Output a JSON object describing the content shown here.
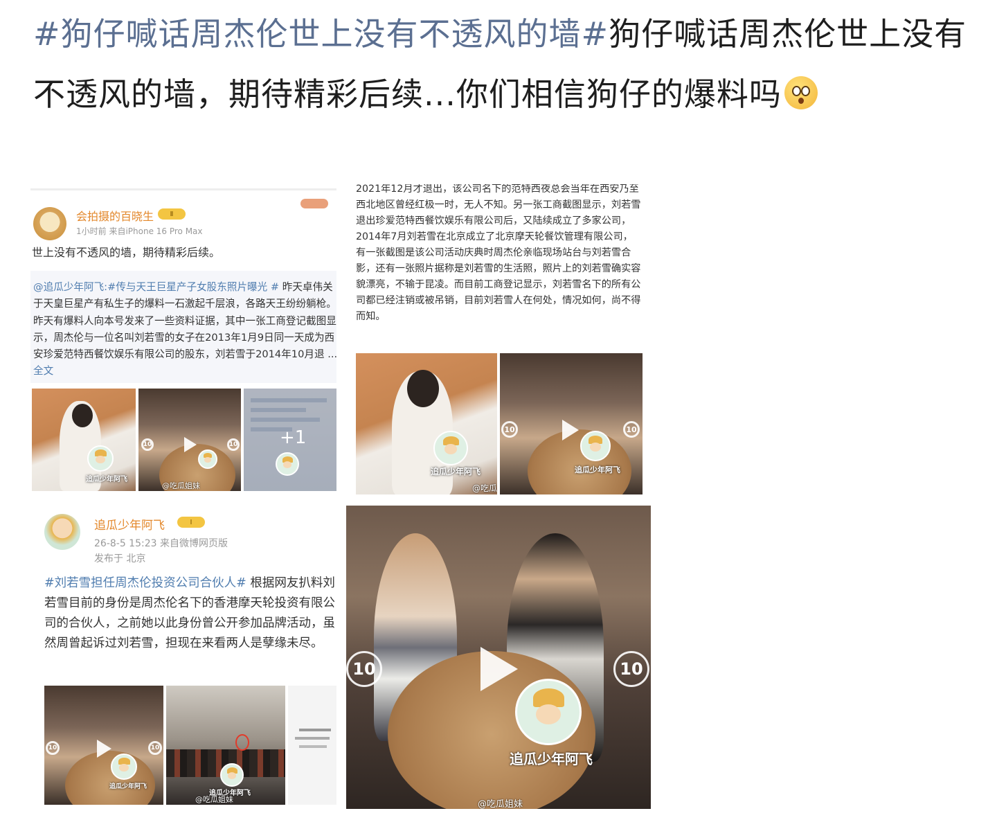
{
  "post": {
    "hashtag": "#狗仔喊话周杰伦世上没有不透风的墙#",
    "text": "狗仔喊话周杰伦世上没有不透风的墙，期待精彩后续...你们相信狗仔的爆料吗"
  },
  "card1": {
    "username": "会拍摄的百晓生",
    "badge": "Ⅱ",
    "meta": "1小时前  来自iPhone 16 Pro Max",
    "text": "世上没有不透风的墙，期待精彩后续。",
    "repost_mention": "@追瓜少年阿飞",
    "repost_tag": ":#传与天王巨星产子女股东照片曝光 #",
    "repost_text": " 昨天卓伟关于天皇巨星产有私生子的爆料一石激起千层浪，各路天王纷纷躺枪。昨天有爆料人向本号发来了一些资料证据，其中一张工商登记截图显示，周杰伦与一位名叫刘若雪的女子在2013年1月9日同一天成为西安珍爱范特西餐饮娱乐有限公司的股东，刘若雪于2014年10月退 ... ",
    "full_text_link": "全文",
    "more_count": "+1",
    "video_watermark": "@吃瓜姐妹",
    "mascot_label": "追瓜少年阿飞",
    "skip": "10"
  },
  "card2": {
    "text": "2021年12月才退出，该公司名下的范特西夜总会当年在西安乃至西北地区曾经红极一时，无人不知。另一张工商截图显示，刘若雪退出珍爱范特西餐饮娱乐有限公司后，又陆续成立了多家公司，2014年7月刘若雪在北京成立了北京摩天轮餐饮管理有限公司，有一张截图是该公司活动庆典时周杰伦亲临现场站台与刘若雪合影，还有一张照片据称是刘若雪的生活照，照片上的刘若雪确实容貌漂亮，不输于昆凌。而目前工商登记显示，刘若雪名下的所有公司都已经注销或被吊销，目前刘若雪人在何处，情况如何，尚不得而知。",
    "watermark": "@吃瓜姐妹",
    "mascot_label": "追瓜少年阿飞",
    "skip": "10"
  },
  "card3": {
    "username": "追瓜少年阿飞",
    "badge": "Ⅰ",
    "meta": "26-8-5 15:23  来自微博网页版",
    "location": "发布于 北京",
    "tag": "#刘若雪担任周杰伦投资公司合伙人#",
    "text": " 根据网友扒料刘若雪目前的身份是周杰伦名下的香港摩天轮投资有限公司的合伙人，之前她以此身份曾公开参加品牌活动，虽然周曾起诉过刘若雪，担现在来看两人是孽缘未尽。",
    "watermark": "@吃瓜姐妹",
    "mascot_label": "追瓜少年阿飞",
    "skip": "10"
  },
  "card4": {
    "mascot_label": "追瓜少年阿飞",
    "watermark": "@吃瓜姐妹",
    "skip": "10"
  }
}
